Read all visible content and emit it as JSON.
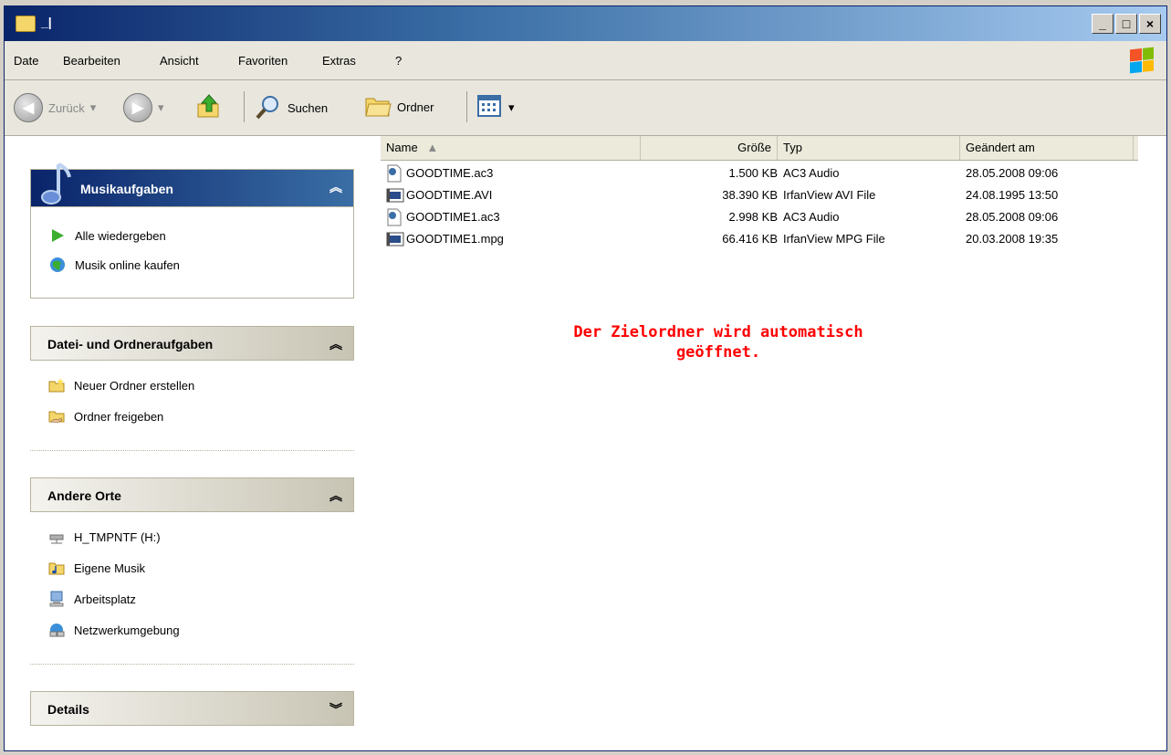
{
  "window": {
    "title": "_|"
  },
  "menu": [
    "Date",
    "Bearbeiten",
    "Ansicht",
    "Favoriten",
    "Extras",
    "?"
  ],
  "toolbar": {
    "back": "Zurück",
    "search": "Suchen",
    "folders": "Ordner"
  },
  "panels": {
    "musik": {
      "title": "Musikaufgaben",
      "items": [
        "Alle wiedergeben",
        "Musik online kaufen"
      ]
    },
    "datei": {
      "title": "Datei- und Ordneraufgaben",
      "items": [
        "Neuer Ordner erstellen",
        "Ordner freigeben"
      ]
    },
    "andere": {
      "title": "Andere Orte",
      "items": [
        "H_TMPNTF (H:)",
        "Eigene Musik",
        "Arbeitsplatz",
        "Netzwerkumgebung"
      ]
    },
    "details": {
      "title": "Details"
    }
  },
  "columns": {
    "name": "Name",
    "size": "Größe",
    "type": "Typ",
    "modified": "Geändert am"
  },
  "files": [
    {
      "name": "GOODTIME.ac3",
      "size": "1.500 KB",
      "type": "AC3 Audio",
      "modified": "28.05.2008 09:06"
    },
    {
      "name": "GOODTIME.AVI",
      "size": "38.390 KB",
      "type": "IrfanView AVI File",
      "modified": "24.08.1995 13:50"
    },
    {
      "name": "GOODTIME1.ac3",
      "size": "2.998 KB",
      "type": "AC3 Audio",
      "modified": "28.05.2008 09:06"
    },
    {
      "name": "GOODTIME1.mpg",
      "size": "66.416 KB",
      "type": "IrfanView MPG File",
      "modified": "20.03.2008 19:35"
    }
  ],
  "message": {
    "line1": "Der Zielordner wird automatisch",
    "line2": "geöffnet."
  }
}
